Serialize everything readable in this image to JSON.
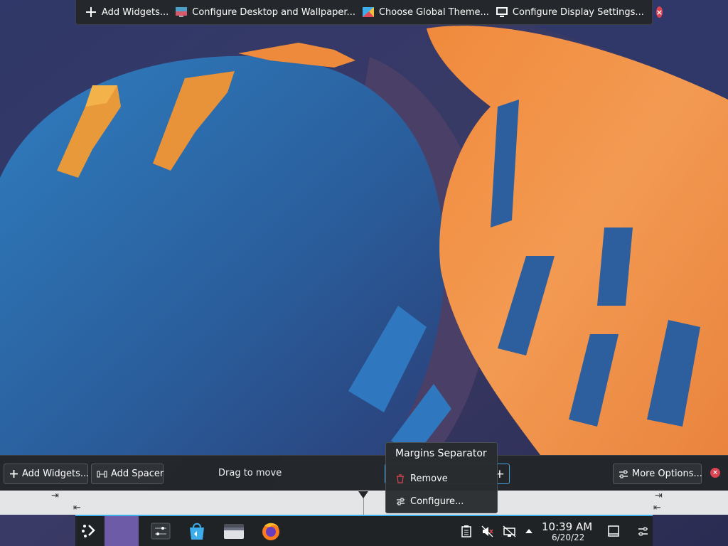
{
  "top_toolbar": {
    "items": [
      {
        "label": "Add Widgets...",
        "icon": "plus-icon"
      },
      {
        "label": "Configure Desktop and Wallpaper...",
        "icon": "desktop-wallpaper-icon"
      },
      {
        "label": "Choose Global Theme...",
        "icon": "global-theme-icon"
      },
      {
        "label": "Configure Display Settings...",
        "icon": "display-settings-icon"
      }
    ],
    "close_icon": "close-icon"
  },
  "panel_edit": {
    "add_widgets_label": "Add Widgets...",
    "add_spacer_label": "Add Spacer",
    "drag_label": "Drag to move",
    "more_options_label": "More Options...",
    "close_icon": "close-icon"
  },
  "popup": {
    "title": "Margins Separator",
    "items": [
      {
        "label": "Remove",
        "icon": "trash-icon"
      },
      {
        "label": "Configure...",
        "icon": "configure-icon"
      }
    ]
  },
  "taskbar": {
    "clock_time": "10:39 AM",
    "clock_date": "6/20/22",
    "launchers": [
      "app-launcher-icon",
      "pager",
      "system-settings-icon",
      "discover-store-icon",
      "file-manager-icon",
      "firefox-icon"
    ],
    "tray": [
      "clipboard-icon",
      "volume-muted-icon",
      "network-icon",
      "tray-expand-icon"
    ]
  },
  "colors": {
    "accent": "#3daee9",
    "close": "#da4453",
    "panel_bg": "#232629",
    "pager": "#6e5ba8"
  }
}
